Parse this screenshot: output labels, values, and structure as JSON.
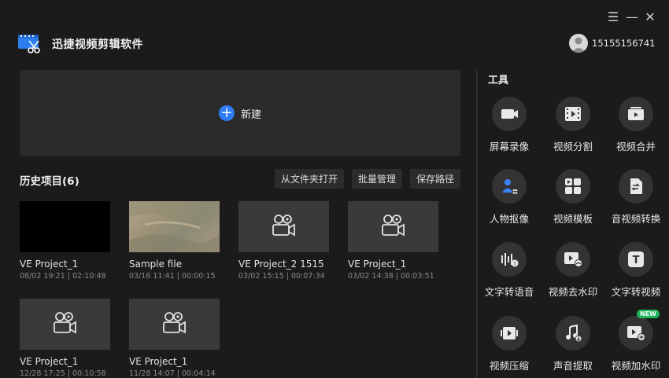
{
  "window": {
    "controls": {
      "menu": "☰",
      "minimize": "—",
      "close": "✕"
    }
  },
  "header": {
    "app_title": "迅捷视频剪辑软件",
    "username": "15155156741"
  },
  "new_project": {
    "plus": "+",
    "label": "新建"
  },
  "history": {
    "title": "历史项目(6)",
    "buttons": {
      "open_folder": "从文件夹打开",
      "batch_manage": "批量管理",
      "save_path": "保存路径"
    },
    "projects": [
      {
        "name": "VE Project_1",
        "meta": "08/02 19:21 | 02:10:48",
        "thumb": "black"
      },
      {
        "name": "Sample file",
        "meta": "03/16 11:41 | 00:00:15",
        "thumb": "aerial-desert"
      },
      {
        "name": "VE Project_2 1515",
        "meta": "03/02 15:15 | 00:07:34",
        "thumb": "camera-icon"
      },
      {
        "name": "VE Project_1",
        "meta": "03/02 14:38 | 00:03:51",
        "thumb": "camera-icon"
      },
      {
        "name": "VE Project_1",
        "meta": "12/28 17:25 | 00:10:58",
        "thumb": "camera-icon"
      },
      {
        "name": "VE Project_1",
        "meta": "11/28 14:07 | 00:04:14",
        "thumb": "camera-icon"
      }
    ]
  },
  "tools": {
    "title": "工具",
    "items": [
      {
        "label": "屏幕录像",
        "icon": "screen-record-icon"
      },
      {
        "label": "视频分割",
        "icon": "video-split-icon"
      },
      {
        "label": "视频合并",
        "icon": "video-merge-icon"
      },
      {
        "label": "人物抠像",
        "icon": "person-cutout-icon"
      },
      {
        "label": "视频模板",
        "icon": "video-template-icon"
      },
      {
        "label": "音视频转换",
        "icon": "av-convert-icon"
      },
      {
        "label": "文字转语音",
        "icon": "text-to-speech-icon"
      },
      {
        "label": "视频去水印",
        "icon": "remove-watermark-icon"
      },
      {
        "label": "文字转视频",
        "icon": "text-to-video-icon"
      },
      {
        "label": "视频压缩",
        "icon": "video-compress-icon"
      },
      {
        "label": "声音提取",
        "icon": "audio-extract-icon"
      },
      {
        "label": "视频加水印",
        "icon": "add-watermark-icon",
        "badge": "NEW"
      }
    ]
  },
  "colors": {
    "accent": "#2f7cf6",
    "new_badge": "#1fb45a",
    "background": "#1b1b1b",
    "panel": "#2b2b2b"
  }
}
